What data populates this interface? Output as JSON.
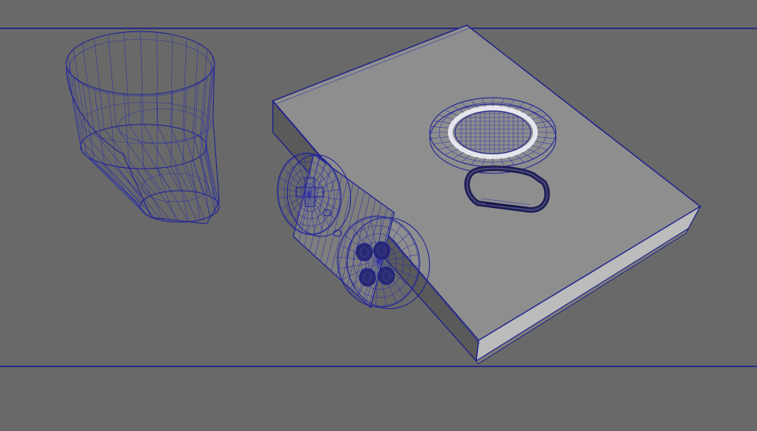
{
  "viewport": {
    "background": "#696969",
    "wireframe_color": "#1b1f96",
    "surface_color": "#8c8c8c",
    "highlight_color": "#e6e6ee"
  },
  "scene": {
    "objects": [
      {
        "name": "glass",
        "icon": "wireframe-glass"
      },
      {
        "name": "book",
        "icon": "wireframe-book"
      },
      {
        "name": "gamepad",
        "icon": "wireframe-gamepad"
      },
      {
        "name": "coaster",
        "icon": "wireframe-coaster"
      },
      {
        "name": "carabiner",
        "icon": "wireframe-carabiner"
      }
    ]
  }
}
